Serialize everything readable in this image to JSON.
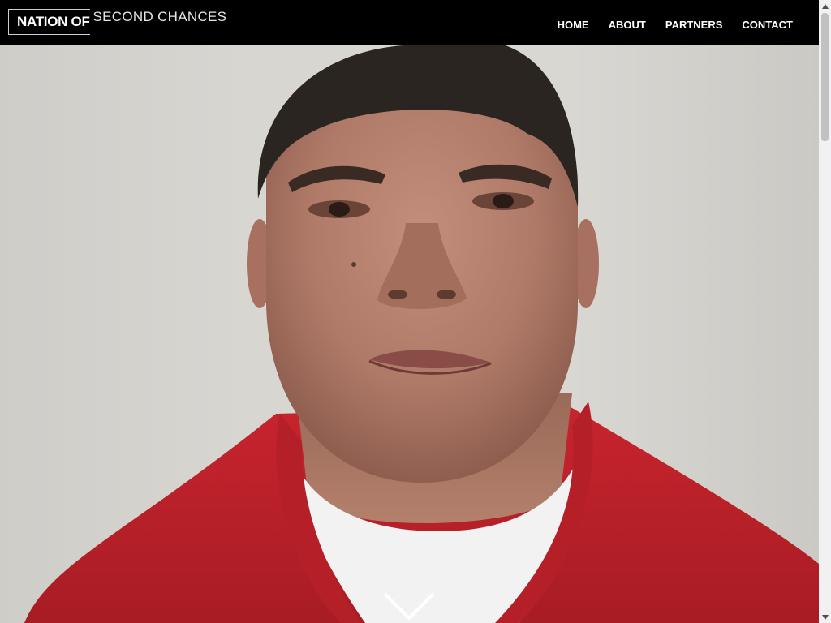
{
  "logo": {
    "bold": "NATION OF",
    "light": "SECOND CHANCES"
  },
  "nav": {
    "items": [
      {
        "label": "HOME"
      },
      {
        "label": "ABOUT"
      },
      {
        "label": "PARTNERS"
      },
      {
        "label": "CONTACT"
      }
    ]
  },
  "hero": {
    "image": "portrait-man-red-polo",
    "scroll_indicator_icon": "chevron-down-icon"
  },
  "colors": {
    "header_bg": "#000000",
    "nav_text": "#ffffff",
    "shirt_red": "#c0232b",
    "background_wall": "#d7d5d0"
  }
}
